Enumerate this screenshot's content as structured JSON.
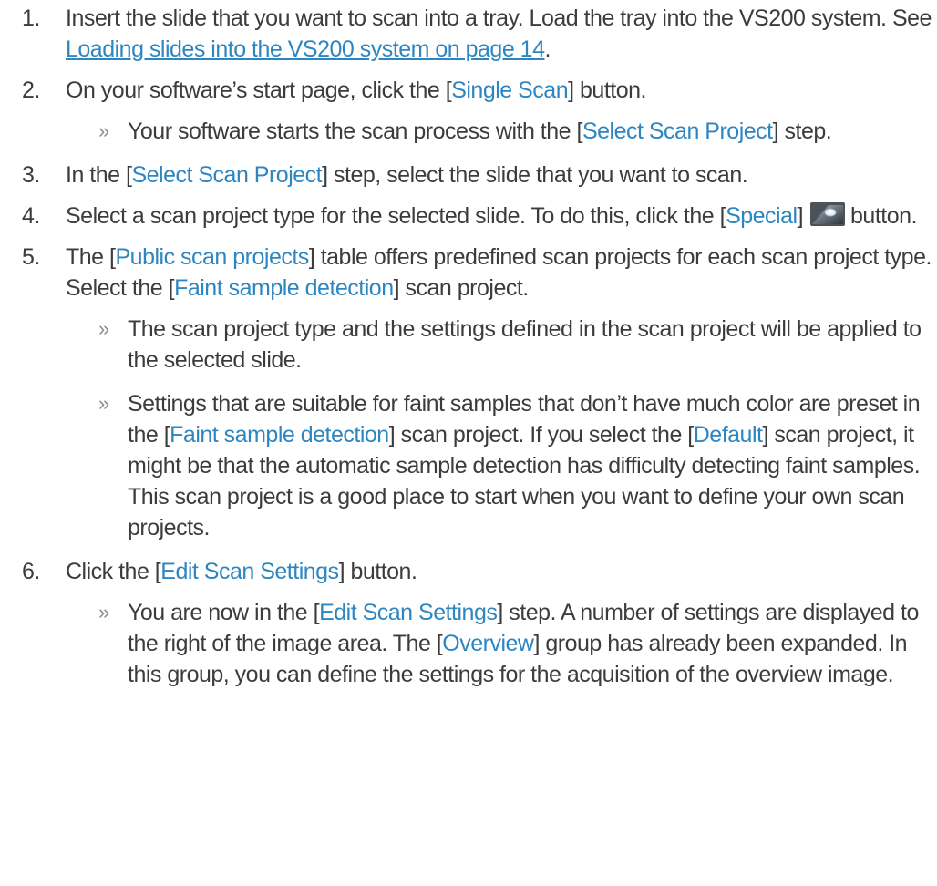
{
  "steps": [
    {
      "num": "1.",
      "a": "Insert the slide that you want to scan into a tray. Load the tray into the VS200 system. See ",
      "link": "Loading slides into the VS200 system on page 14",
      "b": "."
    },
    {
      "num": "2.",
      "a": "On your software’s start page, click the [",
      "ui": "Single Scan",
      "b": "] button.",
      "result": {
        "arrow": "»",
        "a": "Your software starts the scan process with the [",
        "ui": "Select Scan Project",
        "b": "] step."
      }
    },
    {
      "num": "3.",
      "a": "In the [",
      "ui": "Select Scan Project",
      "b": "] step, select the slide that you want to scan."
    },
    {
      "num": "4.",
      "a": "Select a scan project type for the selected slide. To do this, click the [",
      "ui": "Special",
      "b": "]",
      "icon": "special-scan-icon",
      "c": "button."
    },
    {
      "num": "5.",
      "a": "The [",
      "ui": "Public scan projects",
      "b": "] table offers predefined scan projects for each scan project type. Select the [",
      "ui2": "Faint sample detection",
      "c": "] scan project.",
      "results": [
        {
          "arrow": "»",
          "a": "The scan project type and the settings defined in the scan project will be applied to the selected slide."
        },
        {
          "arrow": "»",
          "a": "Settings that are suitable for faint samples that don’t have much color are preset in the [",
          "ui": "Faint sample detection",
          "b": "] scan project. If you select the [",
          "ui2": "Default",
          "c": "] scan project, it might be that the automatic sample detection has difficulty detecting faint samples. This scan project is a good place to start when you want to define your own scan projects."
        }
      ]
    },
    {
      "num": "6.",
      "a": "Click the [",
      "ui": "Edit Scan Settings",
      "b": "] button.",
      "result": {
        "arrow": "»",
        "a": "You are now in the [",
        "ui": "Edit Scan Settings",
        "b": "] step. A number of settings are displayed to the right of the image area. The [",
        "ui2": "Overview",
        "c": "] group has already been expanded. In this group, you can define the settings for the acquisition of the overview image."
      }
    }
  ],
  "colors": {
    "text": "#3c3c3c",
    "ui_accent": "#2e86c1",
    "arrow": "#8c8c8c"
  }
}
